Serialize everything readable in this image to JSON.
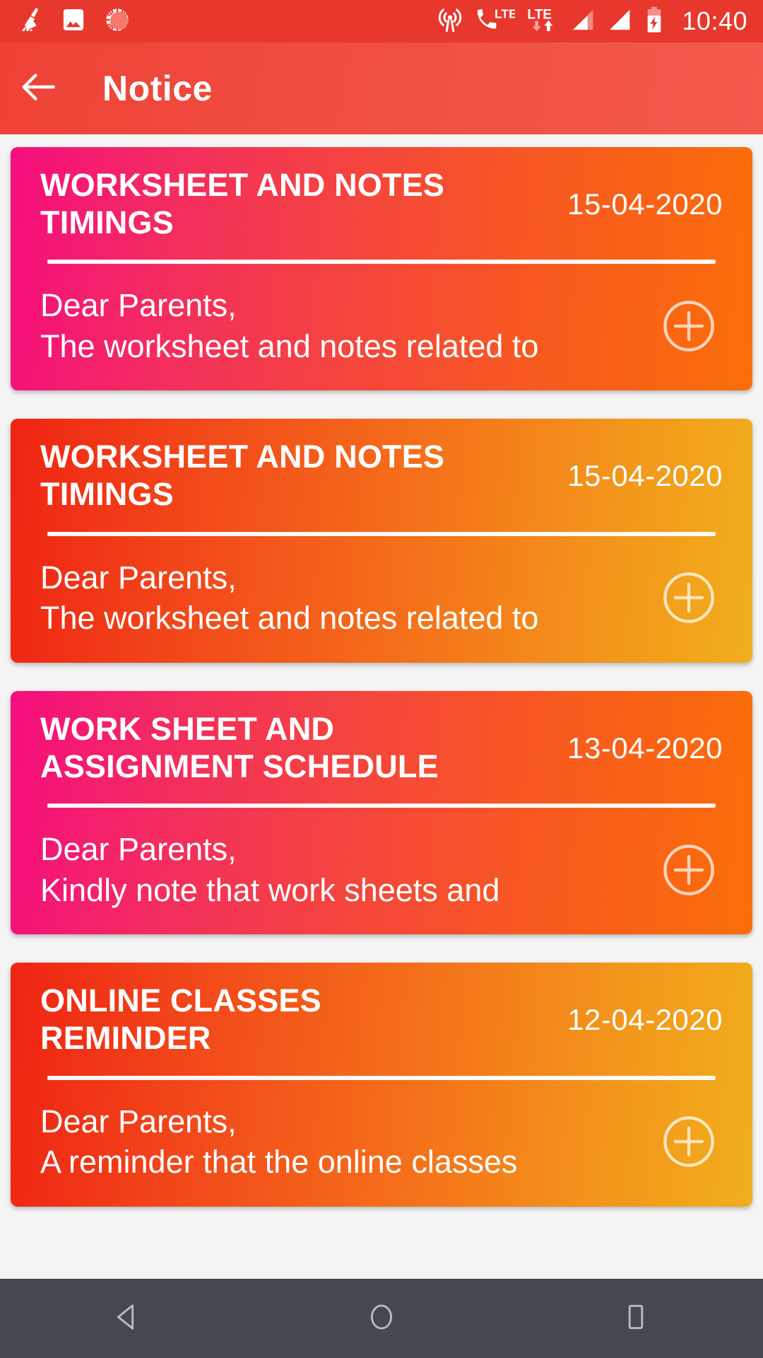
{
  "status_bar": {
    "clock": "10:40",
    "left_icons": [
      "broom-clean-icon",
      "gallery-image-icon",
      "loading-spinner-icon"
    ],
    "right_icons": [
      "hotspot-icon",
      "volte-call-icon",
      "lte-data-icon",
      "signal-bar-sim1-icon",
      "signal-bar-sim2-icon",
      "battery-charging-icon"
    ],
    "background_color": "#e8372c"
  },
  "toolbar": {
    "title": "Notice",
    "back_icon": "arrow-left-icon",
    "background_color": "#f05044"
  },
  "notices": [
    {
      "title": "WORKSHEET AND NOTES TIMINGS",
      "date": "15-04-2020",
      "description": "Dear Parents,\nThe worksheet and notes related to",
      "expand_icon": "plus-circle-icon",
      "gradient": "pink-to-orange",
      "gradient_from": "#f50e7e",
      "gradient_to": "#fa6e0a"
    },
    {
      "title": "WORKSHEET AND NOTES TIMINGS",
      "date": "15-04-2020",
      "description": "Dear Parents,\nThe worksheet and notes related to",
      "expand_icon": "plus-circle-icon",
      "gradient": "red-to-amber",
      "gradient_from": "#ef2413",
      "gradient_to": "#f0ae1c"
    },
    {
      "title": "WORK SHEET AND ASSIGNMENT SCHEDULE",
      "date": "13-04-2020",
      "description": "Dear Parents,\nKindly note that work sheets and",
      "expand_icon": "plus-circle-icon",
      "gradient": "pink-to-orange",
      "gradient_from": "#f50e7e",
      "gradient_to": "#fa6e0a"
    },
    {
      "title": "ONLINE CLASSES REMINDER",
      "date": "12-04-2020",
      "description": "Dear Parents,\nA reminder that the online classes",
      "expand_icon": "plus-circle-icon",
      "gradient": "red-to-amber",
      "gradient_from": "#ef2413",
      "gradient_to": "#f0ae1c"
    }
  ],
  "navbar": {
    "back_label": "back-triangle-icon",
    "home_label": "home-circle-icon",
    "recents_label": "recents-square-icon",
    "background_color": "#43494f"
  }
}
